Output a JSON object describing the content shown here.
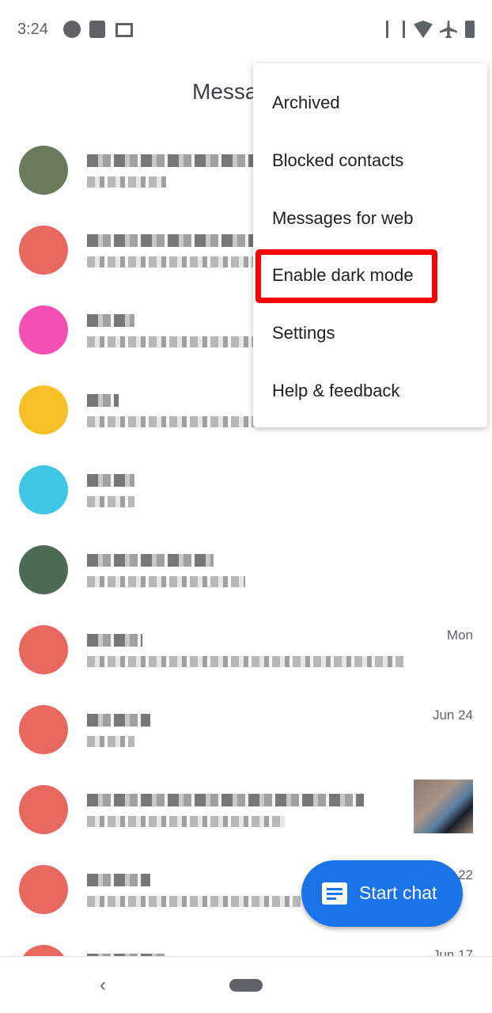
{
  "status_bar": {
    "time": "3:24",
    "left_icons": [
      "spotify-icon",
      "fi-icon",
      "cast-icon"
    ],
    "right_icons": [
      "vibrate-icon",
      "wifi-icon",
      "airplane-icon",
      "battery-icon"
    ]
  },
  "header": {
    "title": "Messages"
  },
  "menu": {
    "items": [
      {
        "label": "Archived"
      },
      {
        "label": "Blocked contacts"
      },
      {
        "label": "Messages for web"
      },
      {
        "label": "Enable dark mode",
        "highlighted": true
      },
      {
        "label": "Settings"
      },
      {
        "label": "Help & feedback"
      }
    ],
    "highlight_color": "#ff0000"
  },
  "conversations": [
    {
      "avatar_color": "#6b7a5a",
      "date": ""
    },
    {
      "avatar_color": "#e8675e",
      "date": ""
    },
    {
      "avatar_color": "#f450b4",
      "date": ""
    },
    {
      "avatar_color": "#f6c026",
      "date": ""
    },
    {
      "avatar_color": "#3fc6e6",
      "date": ""
    },
    {
      "avatar_color": "#4d6a55",
      "date": ""
    },
    {
      "avatar_color": "#e8675e",
      "date": "Mon"
    },
    {
      "avatar_color": "#e8675e",
      "date": "Jun 24"
    },
    {
      "avatar_color": "#e8675e",
      "date": "",
      "has_thumbnail": true
    },
    {
      "avatar_color": "#e8675e",
      "date": "Jun 22"
    },
    {
      "avatar_color": "#e8675e",
      "date": "Jun 17"
    }
  ],
  "fab": {
    "label": "Start chat",
    "color": "#1a73e8",
    "icon": "chat-icon"
  },
  "nav": {
    "back_icon": "back-icon",
    "home_icon": "home-pill-icon"
  }
}
